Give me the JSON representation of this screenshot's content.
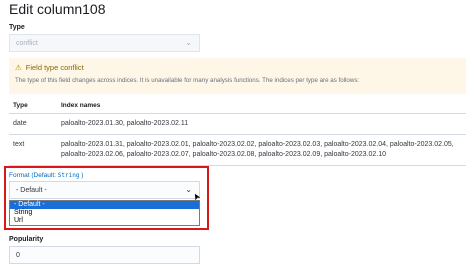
{
  "header": {
    "title": "Edit column108"
  },
  "type_field": {
    "label": "Type",
    "value": "conflict"
  },
  "callout": {
    "title": "Field type conflict",
    "body": "The type of this field changes across indices. It is unavailable for many analysis functions. The indices per type are as follows:"
  },
  "table": {
    "headers": [
      "Type",
      "Index names"
    ],
    "rows": [
      {
        "type": "date",
        "indices": "paloalto-2023.01.30, paloalto-2023.02.11"
      },
      {
        "type": "text",
        "indices": "paloalto-2023.01.31, paloalto-2023.02.01, paloalto-2023.02.02, paloalto-2023.02.03, paloalto-2023.02.04, paloalto-2023.02.05, paloalto-2023.02.06, paloalto-2023.02.07, paloalto-2023.02.08, paloalto-2023.02.09, paloalto-2023.02.10"
      }
    ]
  },
  "format_field": {
    "label_prefix": "Format (Default: ",
    "label_default": "String",
    "label_suffix": " )",
    "value": "- Default -",
    "options": [
      "- Default -",
      "String",
      "Url"
    ],
    "selected_index": 0,
    "highlight_color": "#d7191c",
    "option_highlight_color": "#1a6ed8"
  },
  "popularity_field": {
    "label": "Popularity",
    "value": "0"
  },
  "icons": {
    "chevron": "chevron-down-icon",
    "warning": "warning-icon",
    "cursor": "pointer-cursor-icon"
  }
}
